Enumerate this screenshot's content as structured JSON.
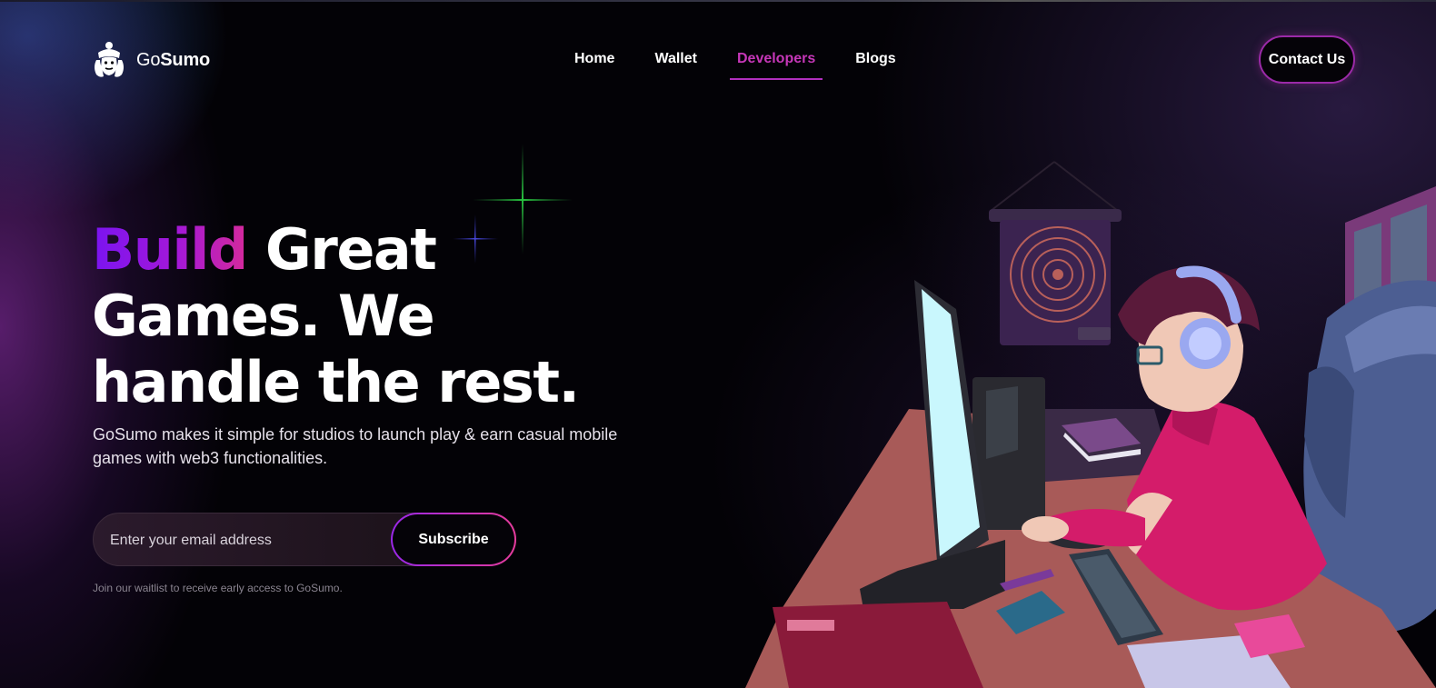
{
  "brand": {
    "name_light": "Go",
    "name_bold": "Sumo",
    "accent_color": "#c637b8"
  },
  "nav": {
    "items": [
      {
        "label": "Home",
        "active": false
      },
      {
        "label": "Wallet",
        "active": false
      },
      {
        "label": "Developers",
        "active": true
      },
      {
        "label": "Blogs",
        "active": false
      }
    ]
  },
  "header": {
    "contact_label": "Contact Us"
  },
  "hero": {
    "title_highlight": "Build",
    "title_line1_rest": " Great",
    "title_line2": "Games. We",
    "title_line3": "handle the rest.",
    "description": "GoSumo makes it simple for studios to launch play & earn casual mobile games with web3 functionalities.",
    "email_placeholder": "Enter your email address",
    "subscribe_label": "Subscribe",
    "waitlist_note": "Join our waitlist to receive early access to GoSumo."
  },
  "icons": {
    "logo": "sumo-wrestler-logo-icon",
    "sparkle_green": "sparkle-icon",
    "sparkle_blue": "sparkle-icon"
  },
  "colors": {
    "background": "#030206",
    "gradient_start": "#7a14f0",
    "gradient_end": "#d52a9b",
    "active_nav": "#c637b8"
  }
}
